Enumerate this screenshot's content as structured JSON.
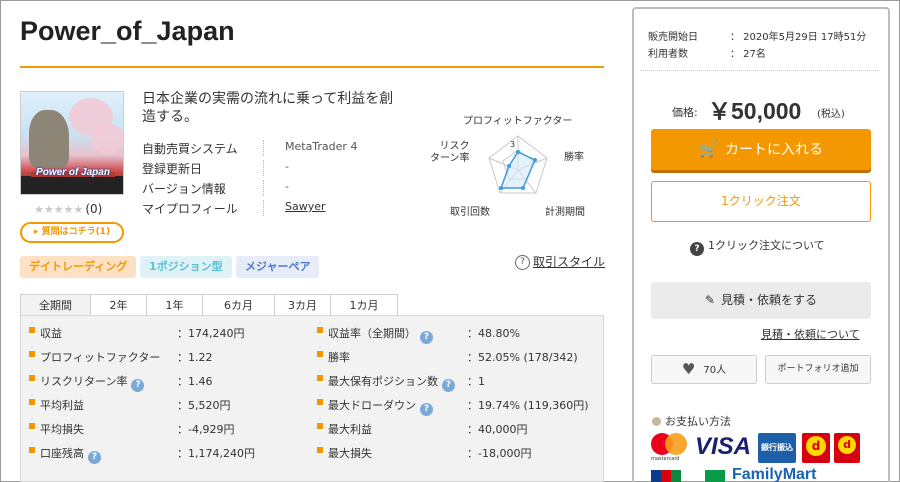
{
  "product": {
    "title": "Power_of_Japan",
    "image_text": "Power of Japan",
    "catch_copy": "日本企業の実需の流れに乗って利益を創造する。",
    "rating_stars": "★★★★★",
    "rating_count": "(0)",
    "buy_here": "▸ 質問はコチラ(1)",
    "info": [
      {
        "label": "自動売買システム",
        "value": "MetaTrader 4"
      },
      {
        "label": "登録更新日",
        "value": "-"
      },
      {
        "label": "バージョン情報",
        "value": "-"
      },
      {
        "label": "マイプロフィール",
        "value": "Sawyer"
      }
    ]
  },
  "radar": {
    "labels": {
      "profit_factor": "プロフィットファクター",
      "win_rate": "勝率",
      "trade_period": "計測期間",
      "trade_count": "取引回数",
      "risk_return": "リスク\nターン率"
    },
    "scale_label": "3"
  },
  "tags": [
    "デイトレーディング",
    "1ポジション型",
    "メジャーペア"
  ],
  "style_link": "取引スタイル",
  "style_icon": "?",
  "period_tabs": [
    "全期間",
    "2年",
    "1年",
    "6カ月",
    "3カ月",
    "1カ月"
  ],
  "stats": {
    "left": [
      {
        "label": "収益",
        "value": "：174,240円",
        "hint": false
      },
      {
        "label": "プロフィットファクター",
        "value": "：1.22",
        "hint": false
      },
      {
        "label": "リスクリターン率",
        "value": "：1.46",
        "hint": true
      },
      {
        "label": "平均利益",
        "value": "：5,520円",
        "hint": false
      },
      {
        "label": "平均損失",
        "value": "：-4,929円",
        "hint": false
      },
      {
        "label": "口座残高",
        "value": "：1,174,240円",
        "hint": true
      }
    ],
    "right": [
      {
        "label": "収益率（全期間）",
        "value": "：48.80%",
        "hint": true
      },
      {
        "label": "勝率",
        "value": "：52.05% (178/342)",
        "hint": false
      },
      {
        "label": "最大保有ポジション数",
        "value": "：1",
        "hint": true
      },
      {
        "label": "最大ドローダウン",
        "value": "：19.74% (119,360円)",
        "hint": true
      },
      {
        "label": "最大利益",
        "value": "：40,000円",
        "hint": false
      },
      {
        "label": "最大損失",
        "value": "：-18,000円",
        "hint": false
      }
    ],
    "hint_icon": "?"
  },
  "sidebar": {
    "meta": [
      {
        "label": "販売開始日",
        "value": "： 2020年5月29日 17時51分"
      },
      {
        "label": "利用者数",
        "value": "： 27名"
      }
    ],
    "price_label": "価格:",
    "price_value": "￥50,000",
    "price_tax": "(税込)",
    "cart_icon": "🛒",
    "cart_button": "カートに入れる",
    "oneclick_button": "1クリック注文",
    "oneclick_about": "1クリック注文について",
    "oneclick_icon": "?",
    "quote_icon": "✎",
    "quote_button": "見積・依頼をする",
    "quote_link": "見積・依頼について",
    "like_icon": "♥",
    "like_count": "70人",
    "portfolio_button": "ポートフォリオ追加",
    "payment_title": "お支払い方法",
    "payment": {
      "mastercard": "mastercard",
      "visa": "VISA",
      "bank": "銀行振込",
      "d_logo": "d",
      "daily_logo": "d",
      "familymart": "FamilyMart"
    }
  },
  "colors": {
    "accent": "#f39800",
    "tag_daytrade": "#f39800",
    "tag_1pos": "#5cbfd6",
    "tag_major": "#4f79d0",
    "radar_line": "#3f9bdc"
  }
}
